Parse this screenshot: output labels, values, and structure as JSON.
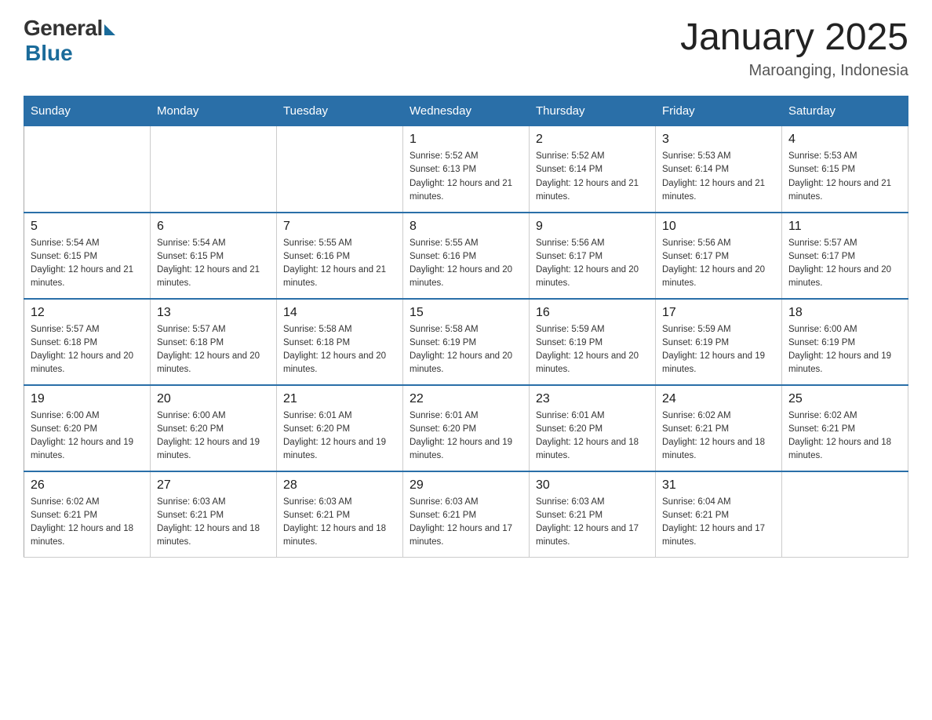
{
  "header": {
    "logo_general": "General",
    "logo_blue": "Blue",
    "title": "January 2025",
    "subtitle": "Maroanging, Indonesia"
  },
  "weekdays": [
    "Sunday",
    "Monday",
    "Tuesday",
    "Wednesday",
    "Thursday",
    "Friday",
    "Saturday"
  ],
  "weeks": [
    [
      {
        "day": "",
        "sunrise": "",
        "sunset": "",
        "daylight": ""
      },
      {
        "day": "",
        "sunrise": "",
        "sunset": "",
        "daylight": ""
      },
      {
        "day": "",
        "sunrise": "",
        "sunset": "",
        "daylight": ""
      },
      {
        "day": "1",
        "sunrise": "Sunrise: 5:52 AM",
        "sunset": "Sunset: 6:13 PM",
        "daylight": "Daylight: 12 hours and 21 minutes."
      },
      {
        "day": "2",
        "sunrise": "Sunrise: 5:52 AM",
        "sunset": "Sunset: 6:14 PM",
        "daylight": "Daylight: 12 hours and 21 minutes."
      },
      {
        "day": "3",
        "sunrise": "Sunrise: 5:53 AM",
        "sunset": "Sunset: 6:14 PM",
        "daylight": "Daylight: 12 hours and 21 minutes."
      },
      {
        "day": "4",
        "sunrise": "Sunrise: 5:53 AM",
        "sunset": "Sunset: 6:15 PM",
        "daylight": "Daylight: 12 hours and 21 minutes."
      }
    ],
    [
      {
        "day": "5",
        "sunrise": "Sunrise: 5:54 AM",
        "sunset": "Sunset: 6:15 PM",
        "daylight": "Daylight: 12 hours and 21 minutes."
      },
      {
        "day": "6",
        "sunrise": "Sunrise: 5:54 AM",
        "sunset": "Sunset: 6:15 PM",
        "daylight": "Daylight: 12 hours and 21 minutes."
      },
      {
        "day": "7",
        "sunrise": "Sunrise: 5:55 AM",
        "sunset": "Sunset: 6:16 PM",
        "daylight": "Daylight: 12 hours and 21 minutes."
      },
      {
        "day": "8",
        "sunrise": "Sunrise: 5:55 AM",
        "sunset": "Sunset: 6:16 PM",
        "daylight": "Daylight: 12 hours and 20 minutes."
      },
      {
        "day": "9",
        "sunrise": "Sunrise: 5:56 AM",
        "sunset": "Sunset: 6:17 PM",
        "daylight": "Daylight: 12 hours and 20 minutes."
      },
      {
        "day": "10",
        "sunrise": "Sunrise: 5:56 AM",
        "sunset": "Sunset: 6:17 PM",
        "daylight": "Daylight: 12 hours and 20 minutes."
      },
      {
        "day": "11",
        "sunrise": "Sunrise: 5:57 AM",
        "sunset": "Sunset: 6:17 PM",
        "daylight": "Daylight: 12 hours and 20 minutes."
      }
    ],
    [
      {
        "day": "12",
        "sunrise": "Sunrise: 5:57 AM",
        "sunset": "Sunset: 6:18 PM",
        "daylight": "Daylight: 12 hours and 20 minutes."
      },
      {
        "day": "13",
        "sunrise": "Sunrise: 5:57 AM",
        "sunset": "Sunset: 6:18 PM",
        "daylight": "Daylight: 12 hours and 20 minutes."
      },
      {
        "day": "14",
        "sunrise": "Sunrise: 5:58 AM",
        "sunset": "Sunset: 6:18 PM",
        "daylight": "Daylight: 12 hours and 20 minutes."
      },
      {
        "day": "15",
        "sunrise": "Sunrise: 5:58 AM",
        "sunset": "Sunset: 6:19 PM",
        "daylight": "Daylight: 12 hours and 20 minutes."
      },
      {
        "day": "16",
        "sunrise": "Sunrise: 5:59 AM",
        "sunset": "Sunset: 6:19 PM",
        "daylight": "Daylight: 12 hours and 20 minutes."
      },
      {
        "day": "17",
        "sunrise": "Sunrise: 5:59 AM",
        "sunset": "Sunset: 6:19 PM",
        "daylight": "Daylight: 12 hours and 19 minutes."
      },
      {
        "day": "18",
        "sunrise": "Sunrise: 6:00 AM",
        "sunset": "Sunset: 6:19 PM",
        "daylight": "Daylight: 12 hours and 19 minutes."
      }
    ],
    [
      {
        "day": "19",
        "sunrise": "Sunrise: 6:00 AM",
        "sunset": "Sunset: 6:20 PM",
        "daylight": "Daylight: 12 hours and 19 minutes."
      },
      {
        "day": "20",
        "sunrise": "Sunrise: 6:00 AM",
        "sunset": "Sunset: 6:20 PM",
        "daylight": "Daylight: 12 hours and 19 minutes."
      },
      {
        "day": "21",
        "sunrise": "Sunrise: 6:01 AM",
        "sunset": "Sunset: 6:20 PM",
        "daylight": "Daylight: 12 hours and 19 minutes."
      },
      {
        "day": "22",
        "sunrise": "Sunrise: 6:01 AM",
        "sunset": "Sunset: 6:20 PM",
        "daylight": "Daylight: 12 hours and 19 minutes."
      },
      {
        "day": "23",
        "sunrise": "Sunrise: 6:01 AM",
        "sunset": "Sunset: 6:20 PM",
        "daylight": "Daylight: 12 hours and 18 minutes."
      },
      {
        "day": "24",
        "sunrise": "Sunrise: 6:02 AM",
        "sunset": "Sunset: 6:21 PM",
        "daylight": "Daylight: 12 hours and 18 minutes."
      },
      {
        "day": "25",
        "sunrise": "Sunrise: 6:02 AM",
        "sunset": "Sunset: 6:21 PM",
        "daylight": "Daylight: 12 hours and 18 minutes."
      }
    ],
    [
      {
        "day": "26",
        "sunrise": "Sunrise: 6:02 AM",
        "sunset": "Sunset: 6:21 PM",
        "daylight": "Daylight: 12 hours and 18 minutes."
      },
      {
        "day": "27",
        "sunrise": "Sunrise: 6:03 AM",
        "sunset": "Sunset: 6:21 PM",
        "daylight": "Daylight: 12 hours and 18 minutes."
      },
      {
        "day": "28",
        "sunrise": "Sunrise: 6:03 AM",
        "sunset": "Sunset: 6:21 PM",
        "daylight": "Daylight: 12 hours and 18 minutes."
      },
      {
        "day": "29",
        "sunrise": "Sunrise: 6:03 AM",
        "sunset": "Sunset: 6:21 PM",
        "daylight": "Daylight: 12 hours and 17 minutes."
      },
      {
        "day": "30",
        "sunrise": "Sunrise: 6:03 AM",
        "sunset": "Sunset: 6:21 PM",
        "daylight": "Daylight: 12 hours and 17 minutes."
      },
      {
        "day": "31",
        "sunrise": "Sunrise: 6:04 AM",
        "sunset": "Sunset: 6:21 PM",
        "daylight": "Daylight: 12 hours and 17 minutes."
      },
      {
        "day": "",
        "sunrise": "",
        "sunset": "",
        "daylight": ""
      }
    ]
  ]
}
